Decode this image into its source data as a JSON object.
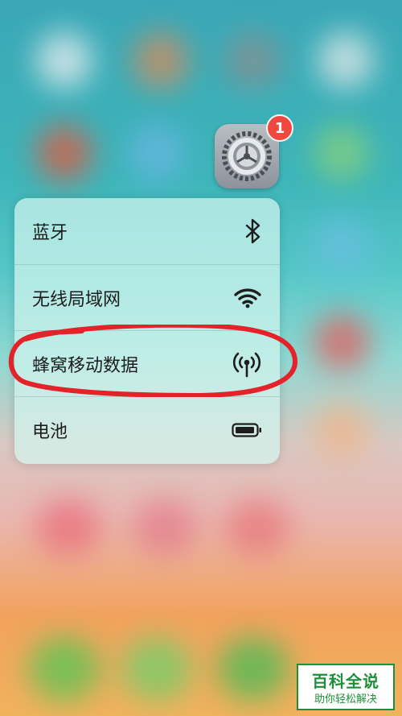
{
  "menu": {
    "items": [
      {
        "label": "蓝牙",
        "icon": "bluetooth-icon"
      },
      {
        "label": "无线局域网",
        "icon": "wifi-icon"
      },
      {
        "label": "蜂窝移动数据",
        "icon": "cellular-icon"
      },
      {
        "label": "电池",
        "icon": "battery-icon"
      }
    ]
  },
  "settings_app": {
    "badge": "1",
    "icon": "settings-gear-icon"
  },
  "colors": {
    "annotation": "#e3222a",
    "badge": "#f0473e",
    "watermark": "#1f8f3a"
  },
  "watermark": {
    "title": "百科全说",
    "subtitle": "助你轻松解决"
  }
}
